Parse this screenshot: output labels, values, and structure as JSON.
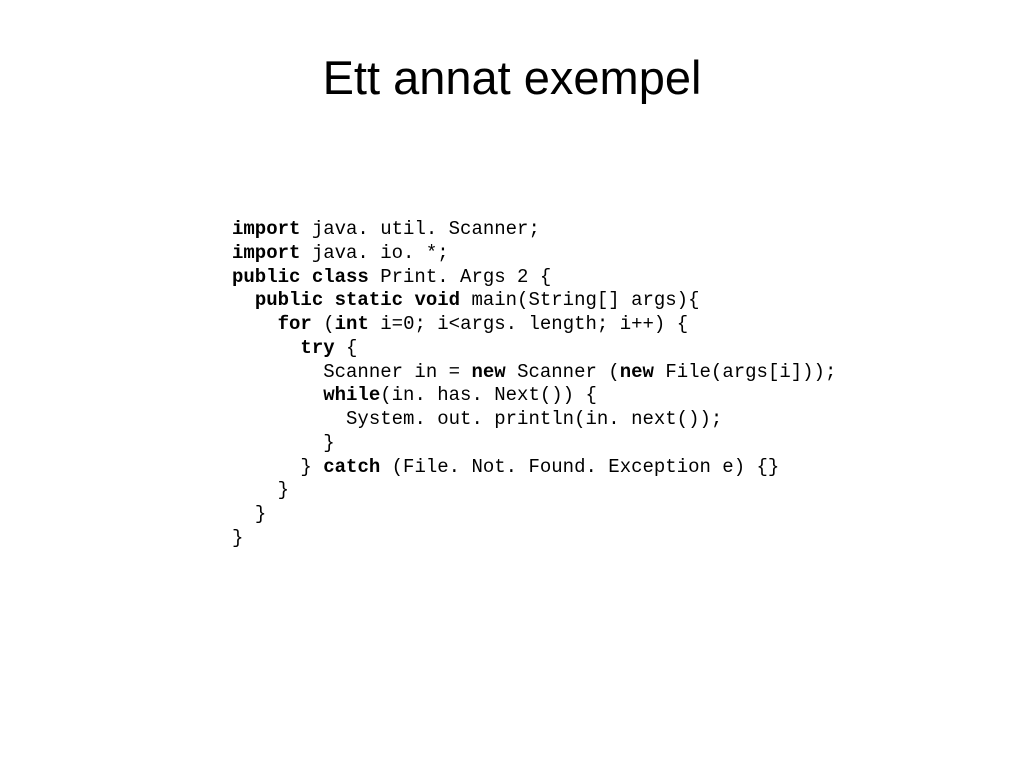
{
  "title": "Ett annat exempel",
  "code": {
    "lines": [
      {
        "indent": 0,
        "spans": [
          {
            "t": "import",
            "b": true
          },
          {
            "t": " java. util. Scanner;"
          }
        ]
      },
      {
        "indent": 0,
        "spans": [
          {
            "t": "import",
            "b": true
          },
          {
            "t": " java. io. *;"
          }
        ]
      },
      {
        "indent": 0,
        "spans": [
          {
            "t": "public class",
            "b": true
          },
          {
            "t": " Print. Args 2 {"
          }
        ]
      },
      {
        "indent": 1,
        "spans": [
          {
            "t": "public static void",
            "b": true
          },
          {
            "t": " main(String[] args){"
          }
        ]
      },
      {
        "indent": 2,
        "spans": [
          {
            "t": "for",
            "b": true
          },
          {
            "t": " ("
          },
          {
            "t": "int",
            "b": true
          },
          {
            "t": " i=0; i<args. length; i++) {"
          }
        ]
      },
      {
        "indent": 3,
        "spans": [
          {
            "t": "try",
            "b": true
          },
          {
            "t": " {"
          }
        ]
      },
      {
        "indent": 4,
        "spans": [
          {
            "t": "Scanner in = "
          },
          {
            "t": "new",
            "b": true
          },
          {
            "t": " Scanner ("
          },
          {
            "t": "new",
            "b": true
          },
          {
            "t": " File(args[i]));"
          }
        ]
      },
      {
        "indent": 4,
        "spans": [
          {
            "t": "while",
            "b": true
          },
          {
            "t": "(in. has. Next()) {"
          }
        ]
      },
      {
        "indent": 5,
        "spans": [
          {
            "t": "System. out. println(in. next());"
          }
        ]
      },
      {
        "indent": 4,
        "spans": [
          {
            "t": "}"
          }
        ]
      },
      {
        "indent": 3,
        "spans": [
          {
            "t": "} "
          },
          {
            "t": "catch",
            "b": true
          },
          {
            "t": " (File. Not. Found. Exception e) {}"
          }
        ]
      },
      {
        "indent": 2,
        "spans": [
          {
            "t": "}"
          }
        ]
      },
      {
        "indent": 1,
        "spans": [
          {
            "t": "}"
          }
        ]
      },
      {
        "indent": 0,
        "spans": [
          {
            "t": "}"
          }
        ]
      }
    ]
  }
}
